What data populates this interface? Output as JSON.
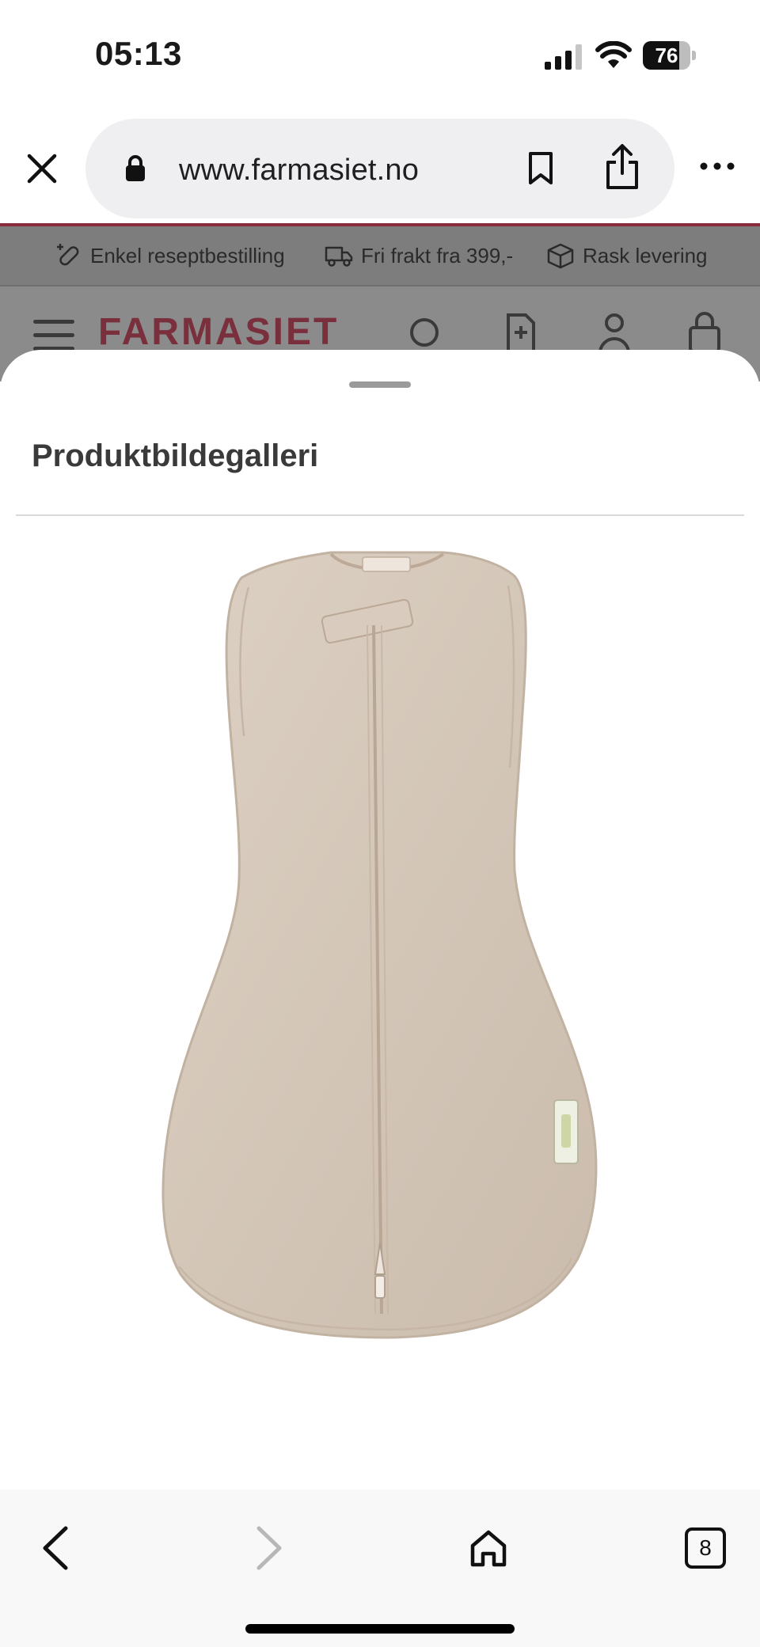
{
  "status_bar": {
    "time": "05:13",
    "battery_level": "76",
    "battery_fraction": 0.76,
    "icons": [
      "signal-icon",
      "wifi-icon",
      "battery-icon"
    ]
  },
  "browser": {
    "url": "www.farmasiet.no",
    "icons": [
      "close-icon",
      "lock-icon",
      "bookmark-icon",
      "share-icon",
      "more-icon"
    ]
  },
  "page_behind": {
    "usp_items": [
      {
        "label": "Enkel reseptbestilling",
        "icon": "prescription-pill-icon"
      },
      {
        "label": "Fri frakt fra 399,-",
        "icon": "truck-icon"
      },
      {
        "label": "Rask levering",
        "icon": "package-icon"
      }
    ],
    "logo": "FARMASIET",
    "header_icons": [
      "menu-icon",
      "search-icon",
      "prescription-icon",
      "account-icon",
      "cart-icon"
    ],
    "accent_color": "#8a2b3c"
  },
  "sheet": {
    "title": "Produktbildegalleri",
    "image": "swaddle-sleep-sack-image"
  },
  "toolbar": {
    "tab_count": "8",
    "icons": [
      "back-icon",
      "forward-icon",
      "home-icon",
      "tabs-icon"
    ]
  }
}
